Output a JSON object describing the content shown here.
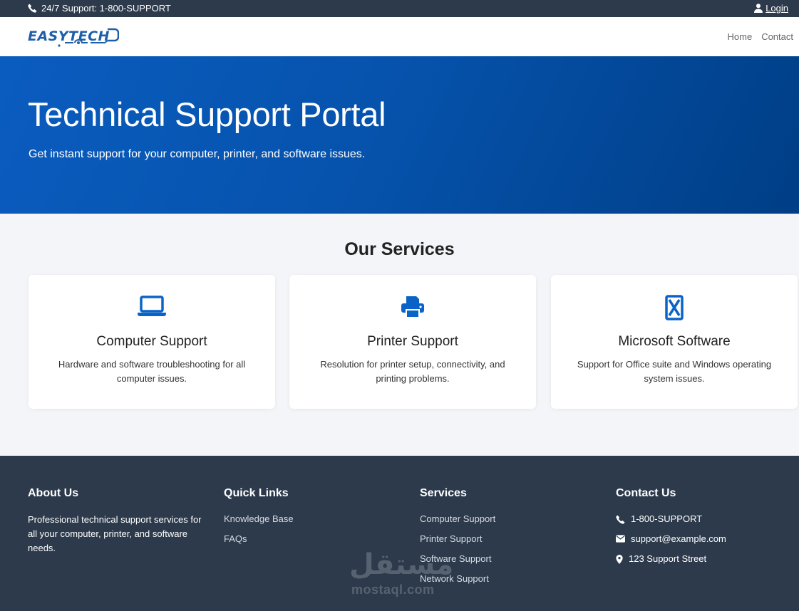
{
  "topbar": {
    "support_text": "24/7 Support: 1-800-SUPPORT",
    "login_label": "Login"
  },
  "header": {
    "logo_text": "EASYTECH",
    "nav": [
      {
        "label": "Home"
      },
      {
        "label": "Contact"
      }
    ]
  },
  "hero": {
    "title": "Technical Support Portal",
    "subtitle": "Get instant support for your computer, printer, and software issues."
  },
  "services": {
    "title": "Our Services",
    "cards": [
      {
        "icon": "laptop-icon",
        "title": "Computer Support",
        "description": "Hardware and software troubleshooting for all computer issues."
      },
      {
        "icon": "printer-icon",
        "title": "Printer Support",
        "description": "Resolution for printer setup, connectivity, and printing problems."
      },
      {
        "icon": "microsoft-icon",
        "title": "Microsoft Software",
        "description": "Support for Office suite and Windows operating system issues."
      }
    ]
  },
  "footer": {
    "about": {
      "title": "About Us",
      "text": "Professional technical support services for all your computer, printer, and software needs."
    },
    "quick_links": {
      "title": "Quick Links",
      "items": [
        "Knowledge Base",
        "FAQs"
      ]
    },
    "services": {
      "title": "Services",
      "items": [
        "Computer Support",
        "Printer Support",
        "Software Support",
        "Network Support"
      ]
    },
    "contact": {
      "title": "Contact Us",
      "phone": "1-800-SUPPORT",
      "email": "support@example.com",
      "address": "123 Support Street"
    }
  },
  "watermark": {
    "arabic": "مستقل",
    "latin": "mostaql.com"
  },
  "colors": {
    "brand_blue": "#0a5cbf",
    "dark_navy": "#2c3a4b",
    "page_bg": "#f4f5f8"
  }
}
